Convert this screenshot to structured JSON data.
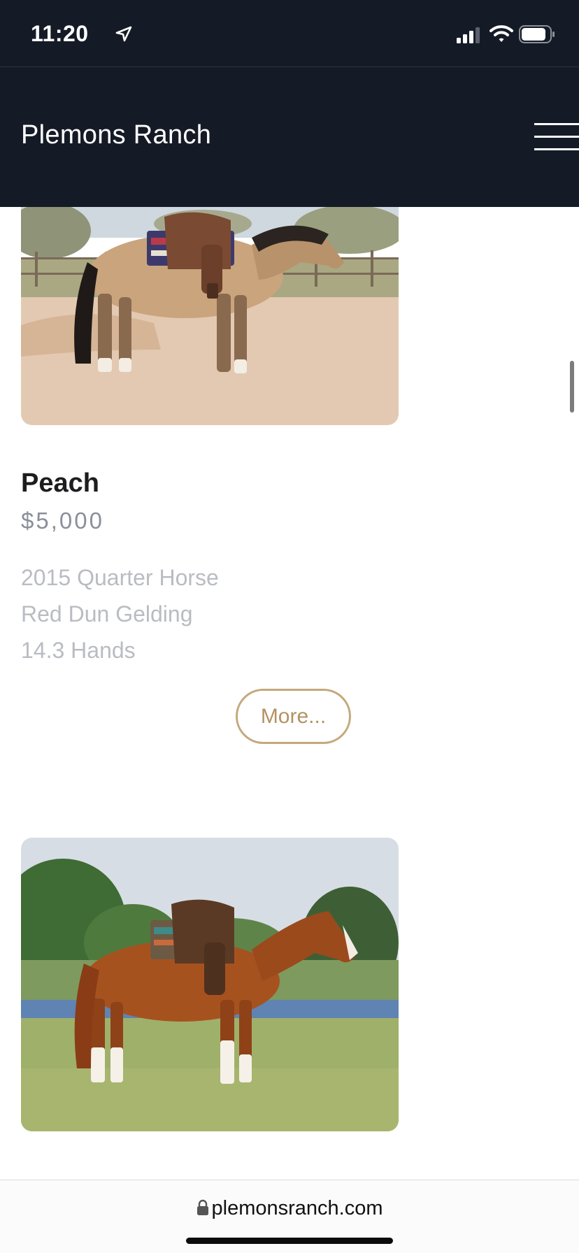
{
  "status_bar": {
    "time": "11:20",
    "icons": [
      "location-arrow-icon",
      "cellular-signal-icon",
      "wifi-icon",
      "battery-icon"
    ]
  },
  "header": {
    "site_title": "Plemons Ranch",
    "menu_icon": "hamburger-menu-icon",
    "background": "#151b26"
  },
  "listings": [
    {
      "photo": "buckskin horse with saddle standing in dirt arena",
      "name": "Peach",
      "price": "$5,000",
      "details": [
        "2015 Quarter Horse",
        "Red Dun Gelding",
        "14.3 Hands"
      ],
      "more_label": "More..."
    },
    {
      "photo": "sorrel horse with saddle standing in grass field by a pond"
    }
  ],
  "browser": {
    "url": "plemonsranch.com",
    "secure_icon": "lock-icon"
  },
  "colors": {
    "accent_gold": "#c4a97c",
    "price_gray": "#8a8f9a",
    "detail_gray": "#b9bcc2"
  }
}
